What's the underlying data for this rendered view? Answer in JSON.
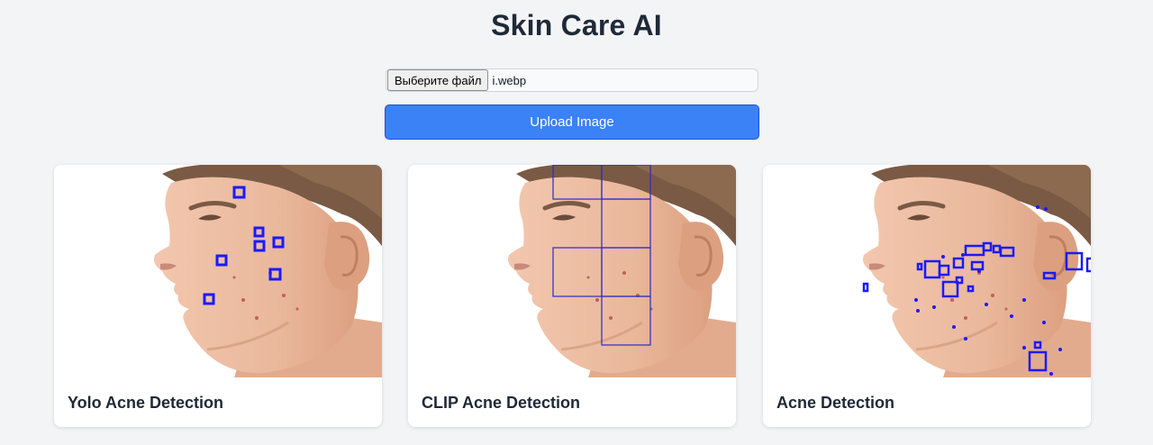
{
  "app": {
    "title": "Skin Care AI"
  },
  "upload": {
    "choose_file_label": "Выберите файл",
    "file_name": "i.webp",
    "upload_button": "Upload Image"
  },
  "cards": [
    {
      "label": "Yolo Acne Detection"
    },
    {
      "label": "CLIP Acne Detection"
    },
    {
      "label": "Acne Detection"
    }
  ],
  "colors": {
    "primary": "#3b82f6",
    "detection_box": "#1a1aff",
    "background": "#f3f4f6"
  }
}
